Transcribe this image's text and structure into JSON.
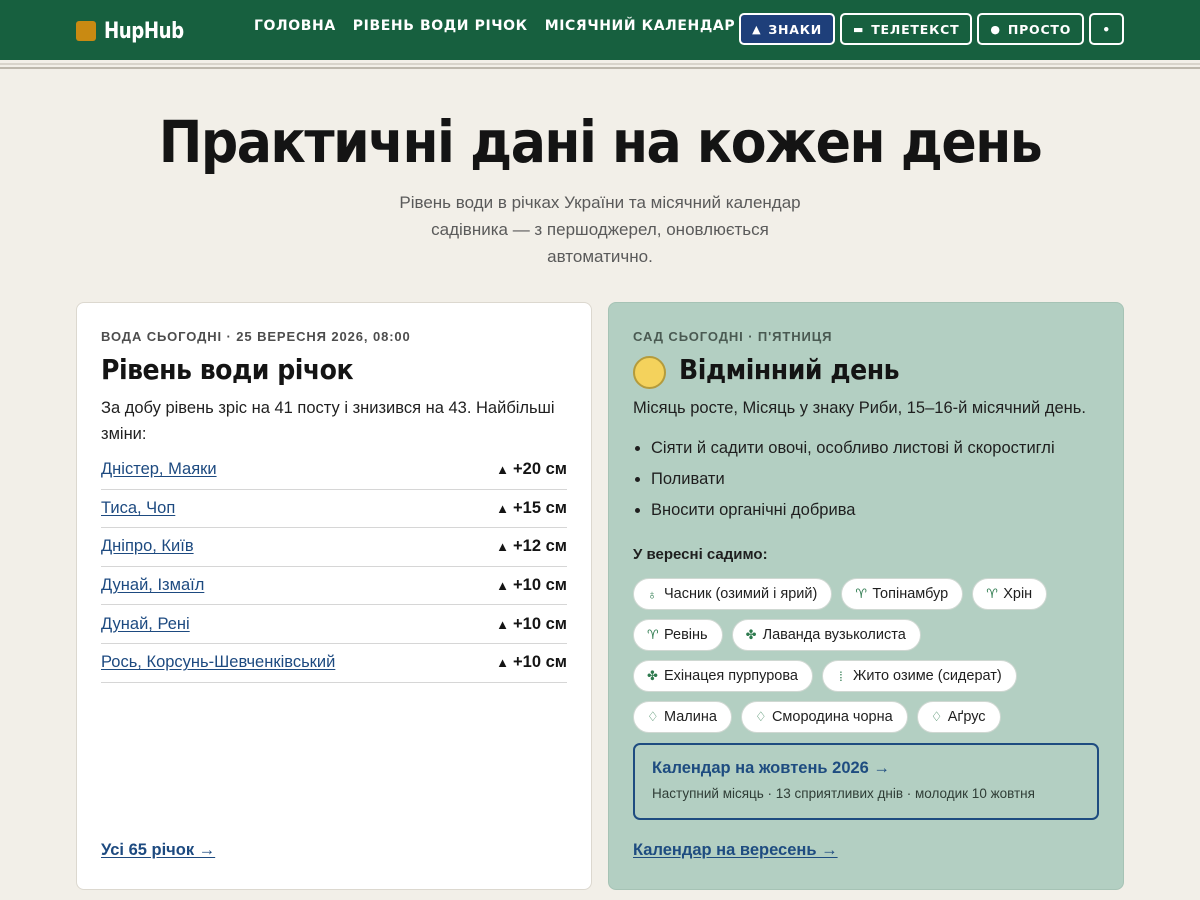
{
  "header": {
    "logo_text": "HupHub",
    "nav": [
      "ГОЛОВНА",
      "РІВЕНЬ ВОДИ РІЧОК",
      "МІСЯЧНИЙ КАЛЕНДАР"
    ],
    "tools": [
      {
        "glyph": "▲",
        "label": "ЗНАКИ",
        "active": true
      },
      {
        "glyph": "▬",
        "label": "ТЕЛЕТЕКСТ",
        "active": false
      },
      {
        "glyph": "●",
        "label": "ПРОСТО",
        "active": false
      },
      {
        "glyph": "•",
        "label": "",
        "active": false
      }
    ]
  },
  "hero": {
    "title": "Практичні дані на кожен день",
    "subtitle": "Рівень води в річках України та місячний календар садівника — з першоджерел, оновлюється автоматично."
  },
  "water": {
    "eyebrow": "ВОДА СЬОГОДНІ · 25 ВЕРЕСНЯ 2026, 08:00",
    "title": "Рівень води річок",
    "summary": "За добу рівень зріс на 41 посту і знизився на 43. Найбільші зміни:",
    "rows": [
      {
        "name": "Дністер, Маяки",
        "change": "+20 см"
      },
      {
        "name": "Тиса, Чоп",
        "change": "+15 см"
      },
      {
        "name": "Дніпро, Київ",
        "change": "+12 см"
      },
      {
        "name": "Дунай, Ізмаїл",
        "change": "+10 см"
      },
      {
        "name": "Дунай, Рені",
        "change": "+10 см"
      },
      {
        "name": "Рось, Корсунь-Шевченківський",
        "change": "+10 см"
      }
    ],
    "more_link": "Усі 65 річок →"
  },
  "garden": {
    "eyebrow": "САД СЬОГОДНІ · П'ЯТНИЦЯ",
    "title": "Відмінний день",
    "summary": "Місяць росте, Місяць у знаку Риби, 15–16-й місячний день.",
    "tips": [
      "Сіяти й садити овочі, особливо листові й скоростиглі",
      "Поливати",
      "Вносити органічні добрива"
    ],
    "sowing_label": "У вересні садимо:",
    "chips": [
      {
        "icon": "garlic-icon",
        "glyph": "♁",
        "label": "Часник (озимий і ярий)"
      },
      {
        "icon": "sprout-icon",
        "glyph": "♈",
        "label": "Топінамбур"
      },
      {
        "icon": "sprout-icon",
        "glyph": "♈",
        "label": "Хрін"
      },
      {
        "icon": "sprout-icon",
        "glyph": "♈",
        "label": "Ревінь"
      },
      {
        "icon": "herb-icon",
        "glyph": "✤",
        "label": "Лаванда вузьколиста"
      },
      {
        "icon": "herb-icon",
        "glyph": "✤",
        "label": "Ехінацея пурпурова"
      },
      {
        "icon": "grain-icon",
        "glyph": "⁞",
        "label": "Жито озиме (сидерат)"
      },
      {
        "icon": "berry-icon",
        "glyph": "♢",
        "label": "Малина"
      },
      {
        "icon": "berry-icon",
        "glyph": "♢",
        "label": "Смородина чорна"
      },
      {
        "icon": "berry-icon",
        "glyph": "♢",
        "label": "Аґрус"
      }
    ],
    "next": {
      "title": "Календар на жовтень 2026 →",
      "subtitle": "Наступний місяць · 13 сприятливих днів · молодик 10 жовтня"
    },
    "calendar_link": "Календар на вересень →"
  },
  "colors": {
    "header_bg": "#17603f",
    "active_tool": "#1e3f7a",
    "link": "#1d4a80",
    "garden_card": "#b3cfc2",
    "moon": "#f4d25c",
    "logo_mark": "#c98a12"
  }
}
